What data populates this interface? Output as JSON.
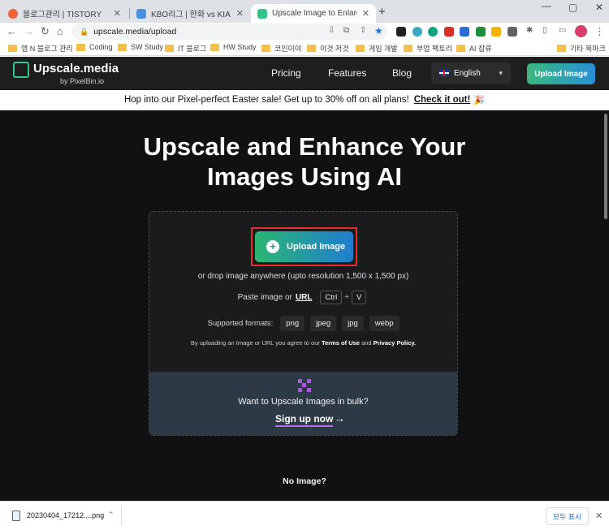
{
  "browser": {
    "tabs": [
      {
        "title": "블로그관리 | TISTORY",
        "favicon_color": "#f0643c",
        "active": false
      },
      {
        "title": "KBO리그 | 한화 vs KIA | 다음스포",
        "favicon_color": "#4a90e2",
        "active": false
      },
      {
        "title": "Upscale Image to Enlarge & Enh",
        "favicon_color": "#34c58c",
        "active": true
      }
    ],
    "new_tab_symbol": "+",
    "window_controls": {
      "minimize": "—",
      "restore": "▢",
      "close": "✕"
    },
    "nav": {
      "back": "←",
      "forward": "→",
      "reload": "↻",
      "home": "⌂"
    },
    "address": "upscale.media/upload",
    "bookmarks": [
      {
        "label": "앱 N 블로그 관리"
      },
      {
        "label": "Coding"
      },
      {
        "label": "SW Study"
      },
      {
        "label": "IT 블로그"
      },
      {
        "label": "HW Study"
      },
      {
        "label": "코인이야"
      },
      {
        "label": "이것 저것"
      },
      {
        "label": "게임 개발"
      },
      {
        "label": "부업 팩토리"
      },
      {
        "label": "AI 잡류"
      },
      {
        "label": "기타 북마크"
      }
    ]
  },
  "site": {
    "logo_text": "Upscale.media",
    "logo_sub": "by PixelBin.io",
    "nav_links": [
      "Pricing",
      "Features",
      "Blog"
    ],
    "language": "English",
    "nav_upload_label": "Upload Image"
  },
  "promo": {
    "text": "Hop into our Pixel-perfect Easter sale! Get up to 30% off on all plans!",
    "cta": "Check it out!",
    "emoji": "🎉"
  },
  "hero": {
    "line1": "Upscale and Enhance Your",
    "line2": "Images Using AI"
  },
  "upload": {
    "button_label": "Upload Image",
    "drop_hint": "or drop image anywhere (upto resolution 1,500 x 1,500 px)",
    "paste_prefix": "Paste image or",
    "url_label": "URL",
    "keys": [
      "Ctrl",
      "V"
    ],
    "key_join": "+",
    "formats_label": "Supported formats:",
    "formats": [
      "png",
      "jpeg",
      "jpg",
      "webp"
    ],
    "terms_prefix": "By uploading an Image or URL you agree to our",
    "terms_link": "Terms of Use",
    "terms_and": "and",
    "privacy_link": "Privacy Policy."
  },
  "bulk": {
    "text": "Want to Upscale Images in bulk?",
    "signup": "Sign up now",
    "arrow": "→"
  },
  "no_image_heading": "No Image?",
  "download_bar": {
    "file_name": "20230404_17212....png",
    "show_all": "모두 표시",
    "close": "✕"
  }
}
